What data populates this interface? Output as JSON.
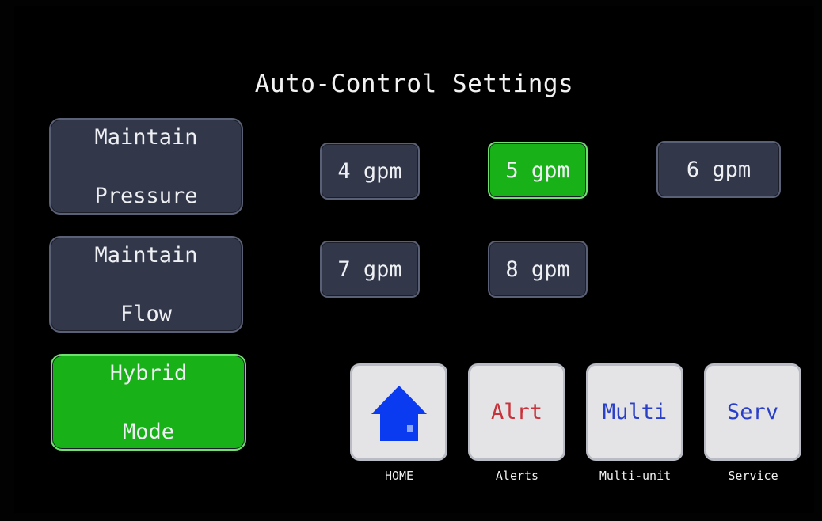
{
  "title": "Auto-Control Settings",
  "modes": [
    {
      "line1": "Maintain",
      "line2": "Pressure",
      "active": false
    },
    {
      "line1": "Maintain",
      "line2": "Flow",
      "active": false
    },
    {
      "line1": "Hybrid",
      "line2": "Mode",
      "active": true
    }
  ],
  "rates": [
    {
      "label": "4 gpm",
      "active": false
    },
    {
      "label": "5 gpm",
      "active": true
    },
    {
      "label": "6 gpm",
      "active": false
    },
    {
      "label": "7 gpm",
      "active": false
    },
    {
      "label": "8 gpm",
      "active": false
    }
  ],
  "nav": {
    "home": {
      "icon": "house-icon",
      "caption": "HOME",
      "color": "#0a3bf0"
    },
    "alerts": {
      "label": "Alrt",
      "caption": "Alerts",
      "color": "#c8323a"
    },
    "multi": {
      "label": "Multi",
      "caption": "Multi-unit",
      "color": "#2a3fc8"
    },
    "service": {
      "label": "Serv",
      "caption": "Service",
      "color": "#2a3fc8"
    }
  },
  "colors": {
    "button_bg": "#323749",
    "active_bg": "#18b218",
    "nav_bg": "#e4e4e6"
  }
}
